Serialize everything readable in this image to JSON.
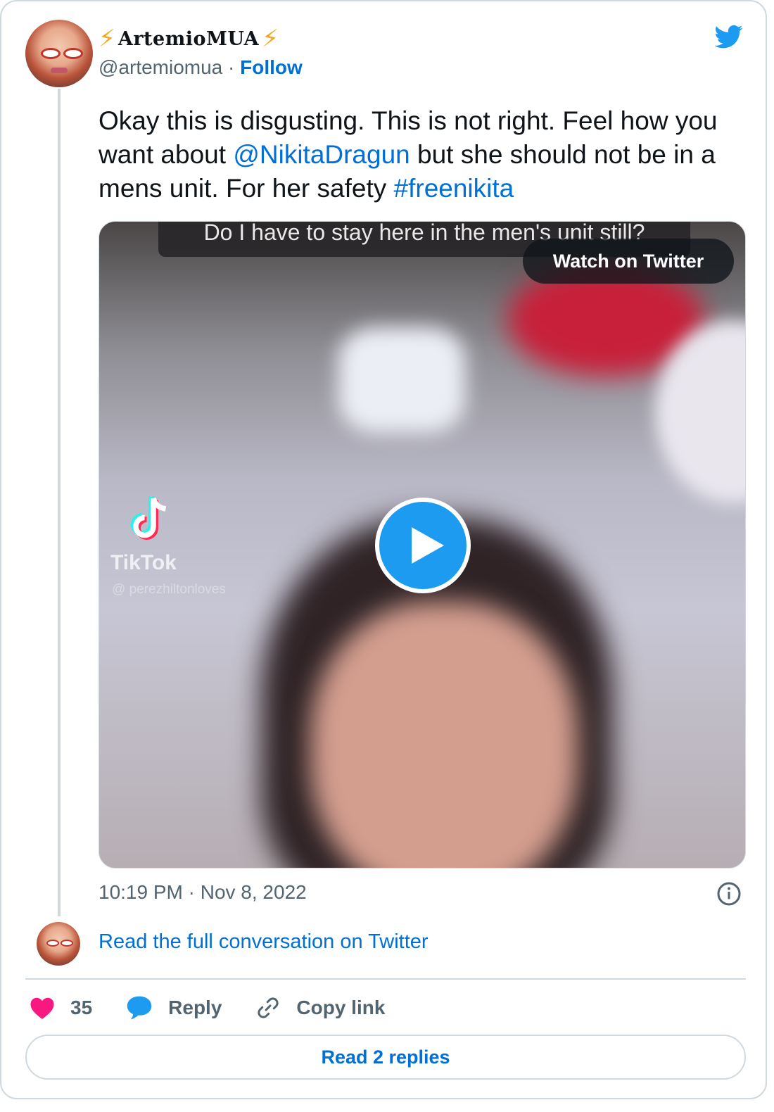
{
  "author": {
    "display_name": "ArtemioMUA",
    "display_prefix": "⚡",
    "display_suffix": "⚡",
    "handle": "@artemiomua",
    "separator": " · ",
    "follow_label": "Follow"
  },
  "tweet": {
    "text_part1": "Okay this is disgusting. This is not right. Feel how you want about ",
    "mention": "@NikitaDragun",
    "text_part2": " but she should not be in a mens unit. For her safety ",
    "hashtag": "#freenikita",
    "timestamp": "10:19 PM · Nov 8, 2022"
  },
  "media": {
    "caption": "Do I have to stay here in the men's unit still?",
    "watch_label": "Watch on Twitter",
    "watermark_brand": "TikTok",
    "watermark_user": "@ perezhiltonloves"
  },
  "conversation": {
    "read_full_label": "Read the full conversation on Twitter"
  },
  "actions": {
    "like_count": "35",
    "reply_label": "Reply",
    "copy_link_label": "Copy link"
  },
  "footer": {
    "read_replies_label": "Read 2 replies"
  },
  "colors": {
    "link": "#006fd6",
    "twitter_blue": "#1d9bf0",
    "heart": "#f91880",
    "muted": "#536471",
    "border": "#cfd9de"
  },
  "icons": {
    "logo": "twitter-bird-icon",
    "info": "info-icon",
    "like": "heart-icon",
    "reply": "speech-bubble-icon",
    "copy": "link-icon",
    "play": "play-icon"
  }
}
